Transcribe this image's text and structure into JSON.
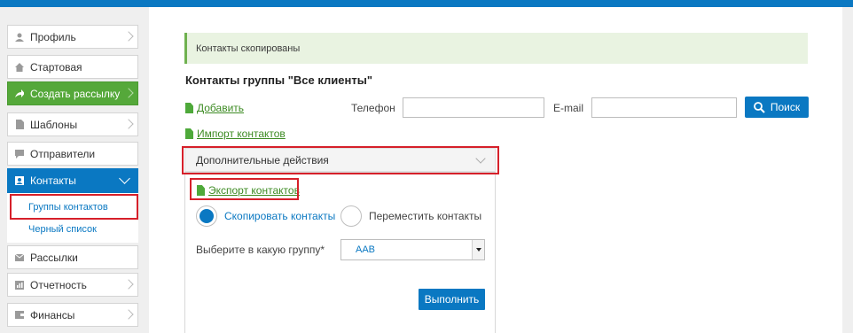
{
  "sidebar": {
    "items": [
      {
        "label": "Профиль",
        "icon": "user-icon"
      },
      {
        "label": "Стартовая",
        "icon": "home-icon"
      },
      {
        "label": "Создать рассылку",
        "icon": "share-arrow-icon"
      },
      {
        "label": "Шаблоны",
        "icon": "document-icon"
      },
      {
        "label": "Отправители",
        "icon": "chat-icon"
      },
      {
        "label": "Контакты",
        "icon": "contacts-icon"
      },
      {
        "label": "Рассылки",
        "icon": "envelope-icon"
      },
      {
        "label": "Отчетность",
        "icon": "report-icon"
      },
      {
        "label": "Финансы",
        "icon": "wallet-icon"
      }
    ],
    "sub_items": [
      {
        "label": "Группы контактов"
      },
      {
        "label": "Черный список"
      }
    ]
  },
  "main": {
    "alert_text": "Контакты скопированы",
    "title": "Контакты группы \"Все клиенты\"",
    "add_link": "Добавить",
    "import_link": "Импорт контактов",
    "phone_label": "Телефон",
    "email_label": "E-mail",
    "phone_value": "",
    "email_value": "",
    "search_button": "Поиск",
    "actions_dropdown": "Дополнительные действия",
    "export_link": "Экспорт контактов",
    "copy_radio": "Скопировать контакты",
    "move_radio": "Переместить контакты",
    "group_label": "Выберите в какую группу*",
    "group_selected": "AAB",
    "run_button": "Выполнить"
  },
  "colors": {
    "brand_blue": "#0a78c2",
    "green": "#55a83a",
    "highlight_red": "#d6202a"
  }
}
